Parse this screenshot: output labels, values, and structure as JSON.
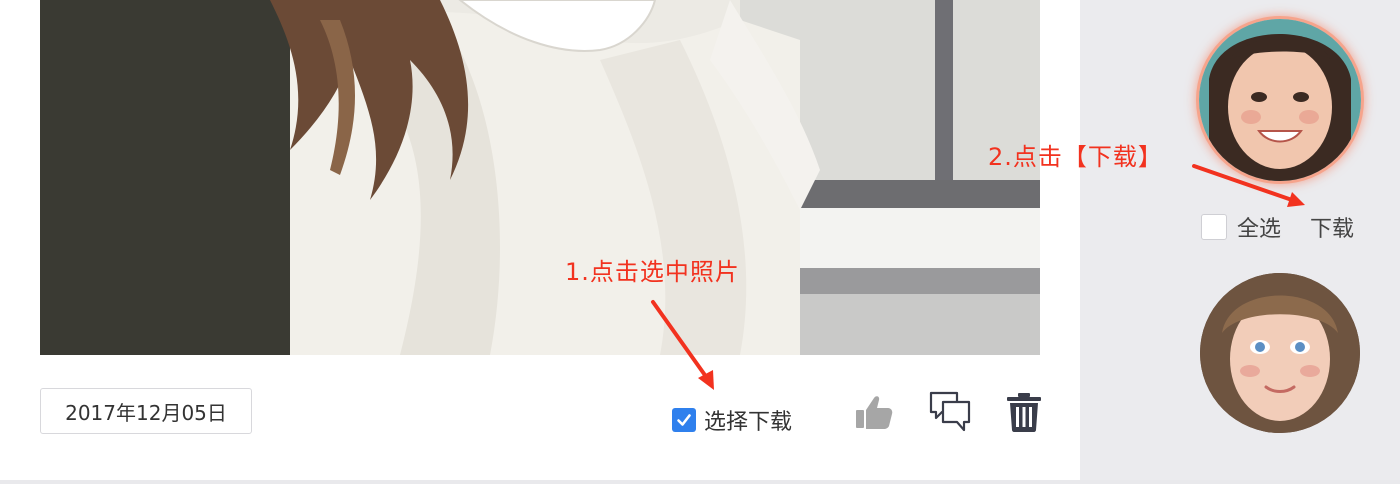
{
  "photo_card": {
    "date": "2017年12月05日",
    "select_download_label": "选择下载",
    "select_download_checked": true,
    "actions": [
      "thumbs-up-icon",
      "comment-icon",
      "trash-icon"
    ]
  },
  "sidebar": {
    "select_all_label": "全选",
    "download_label": "下载"
  },
  "annotations": {
    "step1": "1.点击选中照片",
    "step2": "2.点击【下载】",
    "color": "#f2321f"
  },
  "colors": {
    "checkbox_accent": "#2f80ed",
    "sidebar_bg": "#ebebee",
    "icon_dark": "#3a3d4a",
    "icon_gray": "#9a9a9a"
  }
}
